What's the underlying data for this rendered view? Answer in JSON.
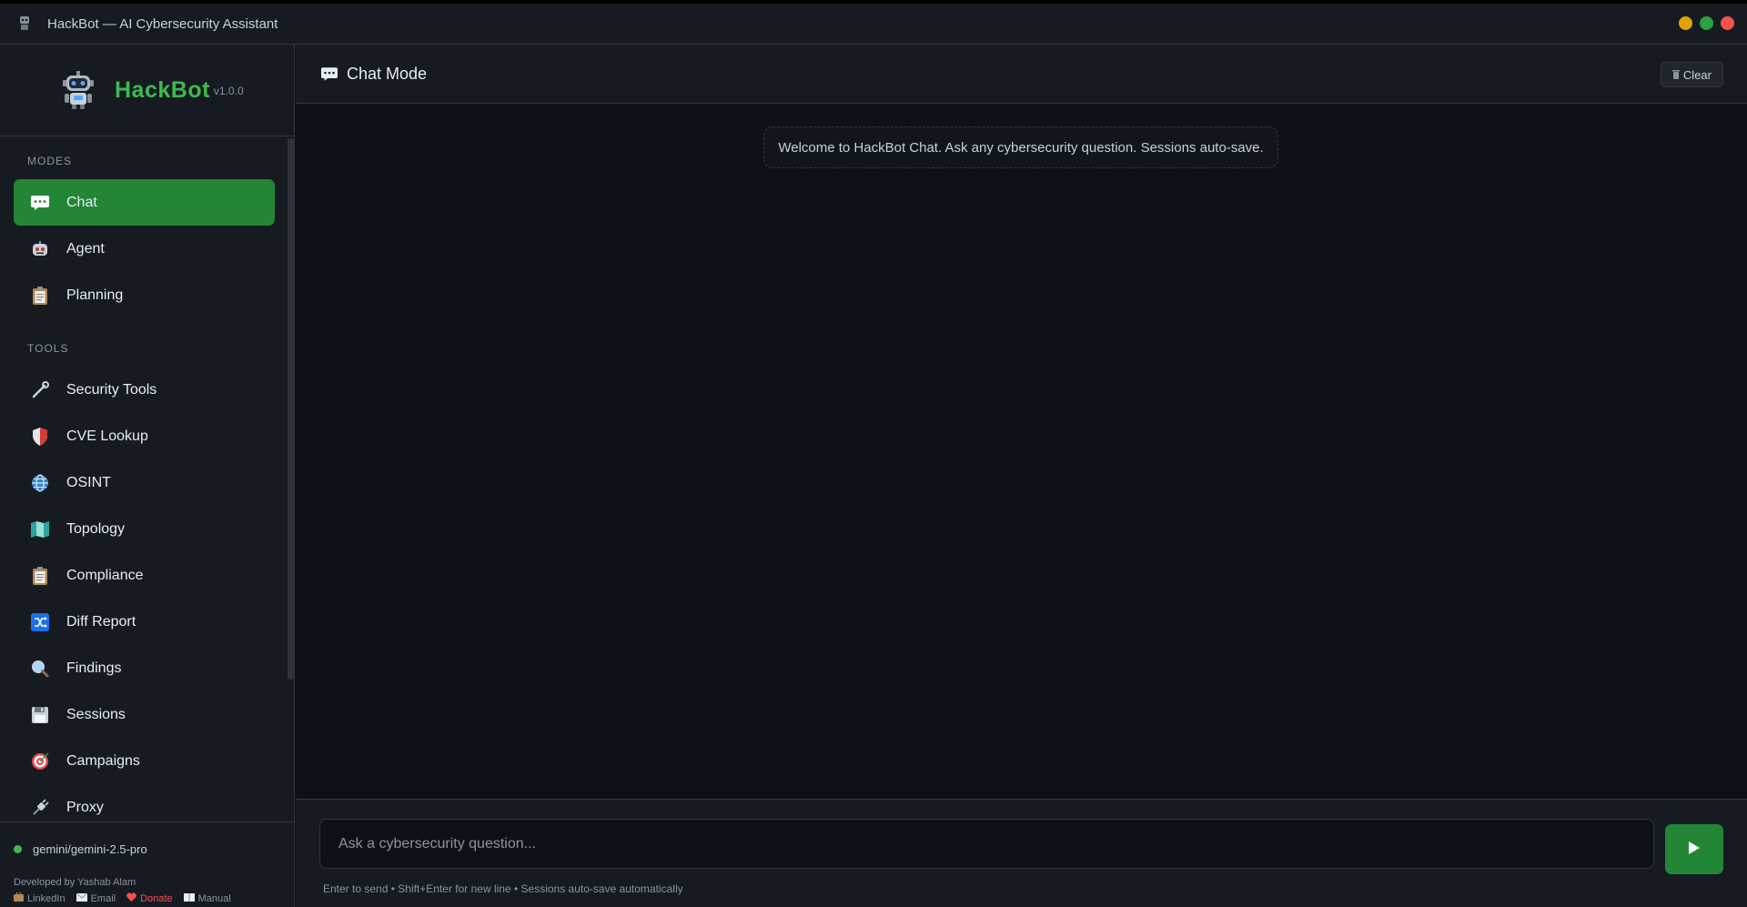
{
  "window": {
    "title": "HackBot — AI Cybersecurity Assistant",
    "controls": [
      {
        "name": "minimize",
        "color": "#e3a008"
      },
      {
        "name": "maximize",
        "color": "#2ea043"
      },
      {
        "name": "close",
        "color": "#f85149"
      }
    ]
  },
  "brand": {
    "name": "HackBot",
    "version": "v1.0.0"
  },
  "sidebar": {
    "modes_label": "MODES",
    "modes": [
      {
        "label": "Chat",
        "icon": "chat-bubble-icon",
        "active": true
      },
      {
        "label": "Agent",
        "icon": "robot-face-icon",
        "active": false
      },
      {
        "label": "Planning",
        "icon": "clipboard-icon",
        "active": false
      }
    ],
    "tools_label": "TOOLS",
    "tools": [
      {
        "label": "Security Tools",
        "icon": "wrench-icon"
      },
      {
        "label": "CVE Lookup",
        "icon": "shield-icon"
      },
      {
        "label": "OSINT",
        "icon": "globe-icon"
      },
      {
        "label": "Topology",
        "icon": "map-icon"
      },
      {
        "label": "Compliance",
        "icon": "clipboard-icon"
      },
      {
        "label": "Diff Report",
        "icon": "shuffle-icon"
      },
      {
        "label": "Findings",
        "icon": "magnifier-icon"
      },
      {
        "label": "Sessions",
        "icon": "floppy-disk-icon"
      },
      {
        "label": "Campaigns",
        "icon": "target-icon"
      },
      {
        "label": "Proxy",
        "icon": "plug-icon"
      }
    ],
    "footer": {
      "model": "gemini/gemini-2.5-pro",
      "developer": "Developed by Yashab Alam",
      "links": [
        {
          "label": "LinkedIn",
          "icon": "briefcase-icon"
        },
        {
          "label": "Email",
          "icon": "envelope-icon"
        },
        {
          "label": "Donate",
          "icon": "heart-icon"
        },
        {
          "label": "Manual",
          "icon": "book-icon"
        }
      ]
    }
  },
  "main": {
    "header_title": "Chat Mode",
    "clear_label": "Clear",
    "welcome": "Welcome to HackBot Chat. Ask any cybersecurity question. Sessions auto-save.",
    "input_placeholder": "Ask a cybersecurity question...",
    "hint": "Enter to send • Shift+Enter for new line • Sessions auto-save automatically"
  },
  "colors": {
    "accent": "#238636",
    "brand_green": "#3fb950",
    "donate": "#f85149",
    "background": "#0d1117",
    "panel": "#161b22"
  }
}
